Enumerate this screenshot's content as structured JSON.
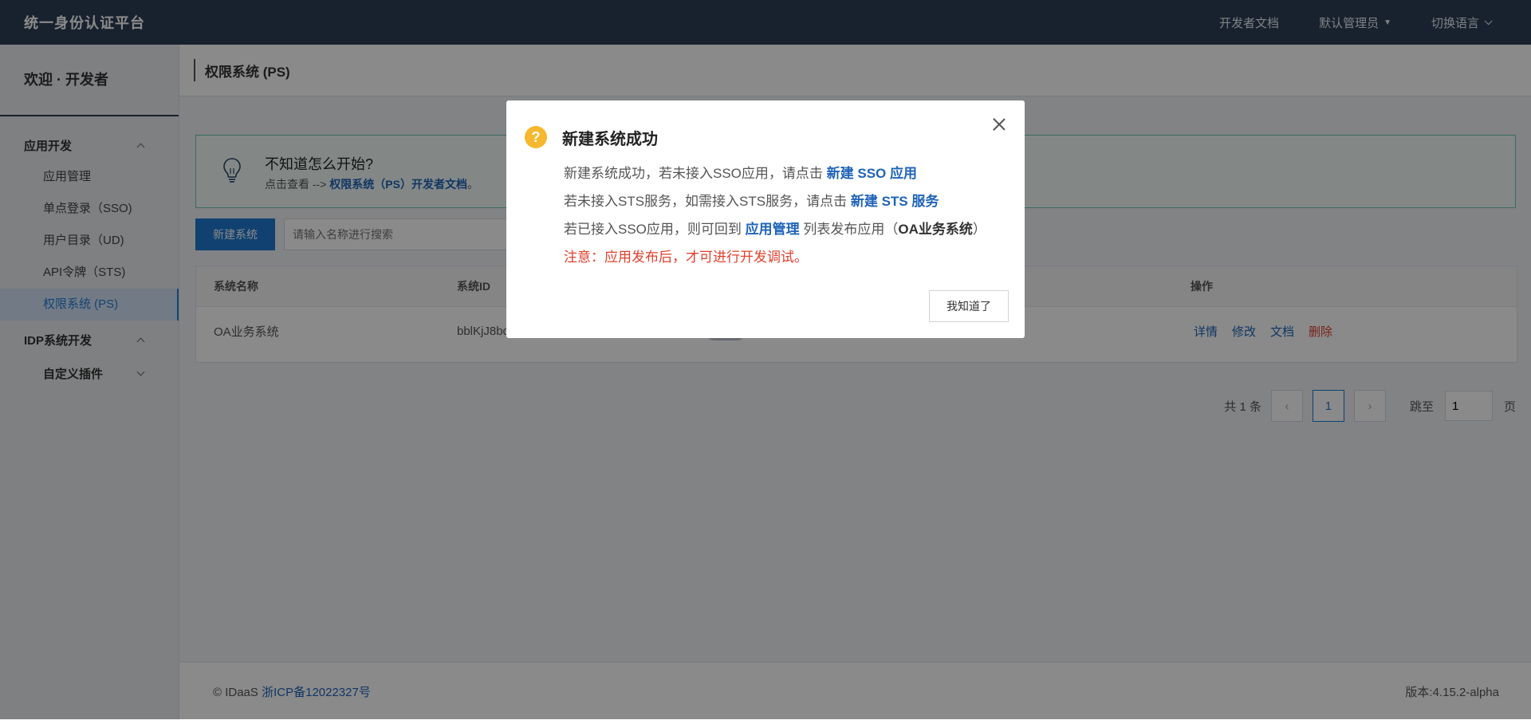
{
  "topbar": {
    "brand": "统一身份认证平台",
    "dev_docs": "开发者文档",
    "admin": "默认管理员",
    "language": "切换语言"
  },
  "sidebar": {
    "welcome": "欢迎 · 开发者",
    "group_app": "应用开发",
    "items": [
      "应用管理",
      "单点登录（SSO)",
      "用户目录（UD)",
      "API令牌（STS)",
      "权限系统 (PS)"
    ],
    "group_idp": "IDP系统开发",
    "plugins": "自定义插件"
  },
  "page": {
    "title": "权限系统 (PS)",
    "tip_title": "不知道怎么开始?",
    "tip_prefix": "点击查看 -->",
    "tip_link": "权限系统（PS）开发者文档",
    "tip_suffix": "。",
    "new_button": "新建系统",
    "search_placeholder": "请输入名称进行搜索"
  },
  "table": {
    "headers": [
      "系统名称",
      "系统ID",
      "操作"
    ],
    "rows": [
      {
        "name": "OA业务系统",
        "id": "bblKjJ8bc",
        "ops": [
          "详情",
          "修改",
          "文档",
          "删除"
        ]
      }
    ]
  },
  "pagination": {
    "total": "共 1 条",
    "current": "1",
    "jump_label": "跳至",
    "jump_value": "1",
    "page_suffix": "页"
  },
  "footer": {
    "copyright": "© IDaaS",
    "icp": "浙ICP备12022327号",
    "version": "版本:4.15.2-alpha"
  },
  "modal": {
    "title": "新建系统成功",
    "line1_text": "新建系统成功，若未接入SSO应用，请点击",
    "line1_link": "新建 SSO 应用",
    "line2_text": "若未接入STS服务，如需接入STS服务，请点击",
    "line2_link": "新建 STS 服务",
    "line3_text": "若已接入SSO应用，则可回到",
    "line3_link": "应用管理",
    "line3_mid": "列表发布应用（",
    "line3_bold": "OA业务系统",
    "line3_end": "）",
    "warning": "注意：应用发布后，才可进行开发调试。",
    "ok_button": "我知道了"
  }
}
